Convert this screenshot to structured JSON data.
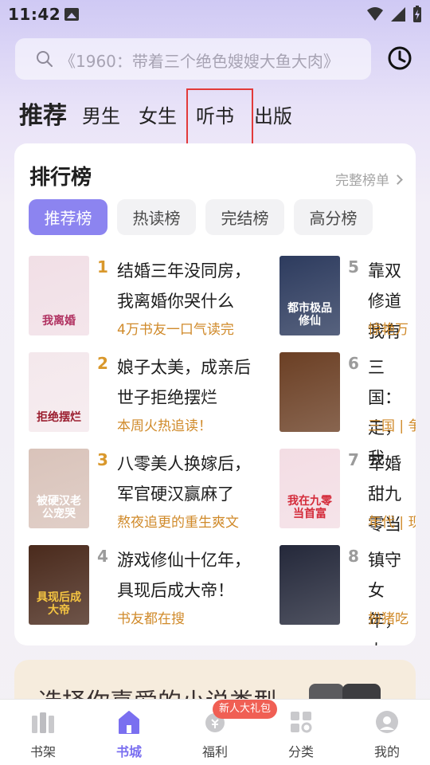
{
  "status_bar": {
    "time": "11:42"
  },
  "search": {
    "placeholder": "《1960：带着三个绝色嫂嫂大鱼大肉》"
  },
  "channel_tabs": [
    {
      "label": "推荐",
      "active": true
    },
    {
      "label": "男生",
      "active": false
    },
    {
      "label": "女生",
      "active": false
    },
    {
      "label": "听书",
      "active": false
    },
    {
      "label": "出版",
      "active": false
    }
  ],
  "ranking": {
    "title": "排行榜",
    "more_label": "完整榜单",
    "tabs": [
      {
        "label": "推荐榜",
        "active": true
      },
      {
        "label": "热读榜",
        "active": false
      },
      {
        "label": "完结榜",
        "active": false
      },
      {
        "label": "高分榜",
        "active": false
      }
    ],
    "books": [
      {
        "rank": "1",
        "title": "结婚三年没同房，我离婚你哭什么",
        "tag": "4万书友一口气读完",
        "cover_text": "我离婚",
        "cover_bg": "#f1dfe6",
        "cover_fg": "#b03060"
      },
      {
        "rank": "2",
        "title": "娘子太美，成亲后世子拒绝摆烂",
        "tag": "本周火热追读！",
        "cover_text": "拒绝摆烂",
        "cover_bg": "#f4e8ec",
        "cover_fg": "#9b1e2f"
      },
      {
        "rank": "3",
        "title": "八零美人换嫁后，军官硬汉赢麻了",
        "tag": "熬夜追更的重生爽文",
        "cover_text": "被硬汉老公宠哭",
        "cover_bg": "#d9c3ba",
        "cover_fg": "#ffffff"
      },
      {
        "rank": "4",
        "title": "游戏修仙十亿年，具现后成大帝！",
        "tag": "书友都在搜",
        "cover_text": "具现后成大帝",
        "cover_bg": "#4a2a1c",
        "cover_fg": "#f5c542"
      },
      {
        "rank": "5",
        "title": "靠双修道我有",
        "tag": "惊艳万",
        "cover_text": "都市极品修仙",
        "cover_bg": "#2d3b5e",
        "cover_fg": "#ffffff"
      },
      {
        "rank": "6",
        "title": "三国：走，我",
        "tag": "三国 | 争",
        "cover_text": "",
        "cover_bg": "#6b3f24",
        "cover_fg": "#f4d27a"
      },
      {
        "rank": "7",
        "title": "军婚甜九零当",
        "tag": "年代 | 现",
        "cover_text": "我在九零当首富",
        "cover_bg": "#f3dde4",
        "cover_fg": "#d42b3a"
      },
      {
        "rank": "8",
        "title": "镇守女年，大",
        "tag": "扮猪吃",
        "cover_text": "",
        "cover_bg": "#24283a",
        "cover_fg": "#f5d35a"
      }
    ]
  },
  "banner": {
    "title": "选择你喜爱的小说类型"
  },
  "gift_badge": "新人大礼包",
  "bottom_nav": [
    {
      "label": "书架",
      "active": false
    },
    {
      "label": "书城",
      "active": true
    },
    {
      "label": "福利",
      "active": false
    },
    {
      "label": "分类",
      "active": false
    },
    {
      "label": "我的",
      "active": false
    }
  ],
  "colors": {
    "accent": "#8c84f0",
    "tag": "#d08a2a",
    "rank_top": "#d9982c",
    "rank_other": "#9b9b9b",
    "highlight_box": "#e23a3a"
  }
}
